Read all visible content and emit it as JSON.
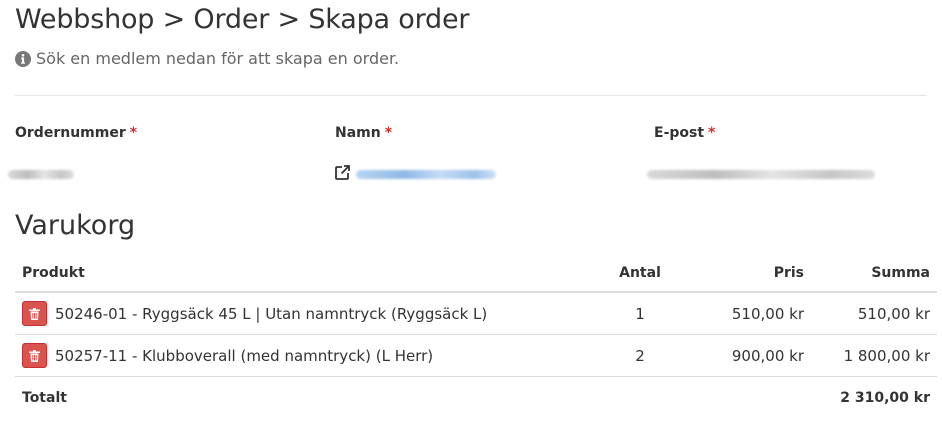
{
  "header": {
    "title": "Webbshop > Order > Skapa order",
    "subtitle": "Sök en medlem nedan för att skapa en order."
  },
  "fields": {
    "order_number_label": "Ordernummer",
    "name_label": "Namn",
    "email_label": "E-post",
    "required_mark": "*"
  },
  "cart": {
    "title": "Varukorg",
    "columns": {
      "product": "Produkt",
      "quantity": "Antal",
      "price": "Pris",
      "sum": "Summa"
    },
    "rows": [
      {
        "product": "50246-01 - Ryggsäck 45 L | Utan namntryck (Ryggsäck L)",
        "quantity": "1",
        "price": "510,00 kr",
        "sum": "510,00 kr"
      },
      {
        "product": "50257-11 - Klubboverall (med namntryck) (L Herr)",
        "quantity": "2",
        "price": "900,00 kr",
        "sum": "1 800,00 kr"
      }
    ],
    "total_label": "Totalt",
    "total_value": "2 310,00 kr"
  },
  "colors": {
    "delete_button": "#d9534f",
    "required": "#c9302c"
  },
  "icons": {
    "subtitle": "info-circle-icon",
    "name_link": "external-link-icon",
    "row_action": "trash-icon"
  }
}
